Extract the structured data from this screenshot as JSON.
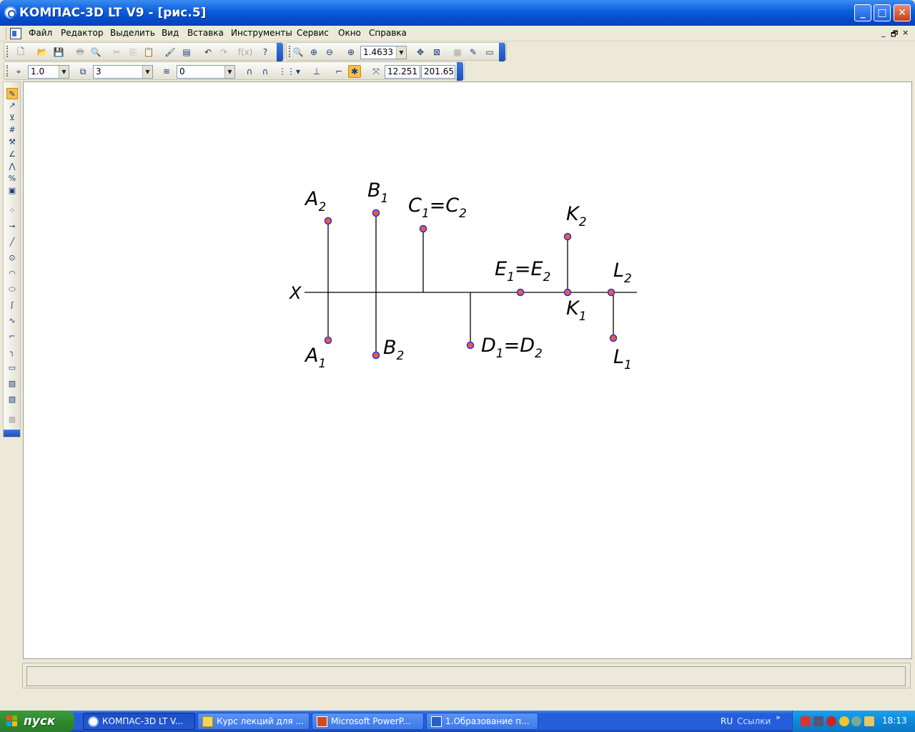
{
  "window": {
    "title": "КОМПАС-3D LT V9 - [рис.5]"
  },
  "menu": {
    "items": [
      "Файл",
      "Редактор",
      "Выделить",
      "Вид",
      "Вставка",
      "Инструменты",
      "Сервис",
      "Окно",
      "Справка"
    ],
    "mdi_buttons": [
      "_",
      "🗗",
      "×"
    ]
  },
  "toolbar_standard": {
    "zoom_value": "1.4633"
  },
  "toolbar_current": {
    "step_value": "1.0",
    "style_value": "3",
    "layer_value": "0",
    "coord_x": "12.251",
    "coord_y": "201.65"
  },
  "drawing": {
    "axis_label": "X",
    "points": [
      {
        "label": "A",
        "sub": "2"
      },
      {
        "label": "A",
        "sub": "1"
      },
      {
        "label": "B",
        "sub": "1"
      },
      {
        "label": "B",
        "sub": "2"
      },
      {
        "label": "C",
        "sub": "1",
        "suffix": "=C",
        "sub2": "2"
      },
      {
        "label": "D",
        "sub": "1",
        "suffix": "=D",
        "sub2": "2"
      },
      {
        "label": "E",
        "sub": "1",
        "suffix": "=E",
        "sub2": "2"
      },
      {
        "label": "K",
        "sub": "2"
      },
      {
        "label": "K",
        "sub": "1"
      },
      {
        "label": "L",
        "sub": "2"
      },
      {
        "label": "L",
        "sub": "1"
      }
    ],
    "point_color": "#e8602c",
    "point_outline": "#2a2aff"
  },
  "statusbar": {
    "text": ""
  },
  "taskbar": {
    "start_label": "пуск",
    "tasks": [
      {
        "label": "КОМПАС-3D LT V...",
        "active": true
      },
      {
        "label": "Курс лекций для ...",
        "active": false
      },
      {
        "label": "Microsoft PowerP...",
        "active": false
      },
      {
        "label": "1.Образование п...",
        "active": false
      }
    ],
    "lang": "RU",
    "links_label": "Ссылки",
    "links_chevron": "»",
    "clock": "18:13"
  }
}
